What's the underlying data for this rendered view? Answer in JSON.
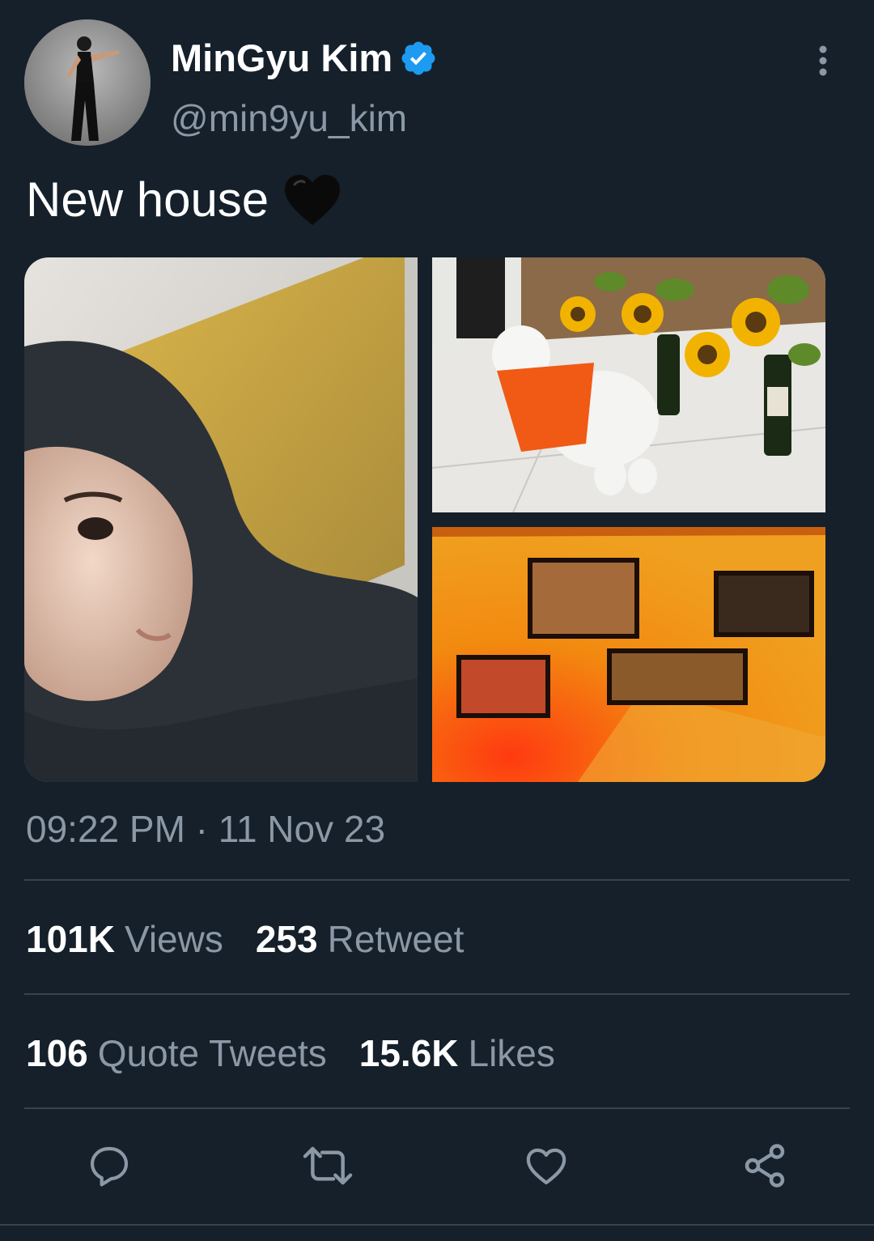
{
  "author": {
    "display_name": "MinGyu Kim",
    "handle": "@min9yu_kim",
    "verified": true,
    "avatar_icon": "avatar"
  },
  "tweet": {
    "text": "New house",
    "emoji": "black-heart-icon",
    "timestamp": "09:22 PM · 11 Nov 23"
  },
  "media": {
    "count": 3,
    "items": [
      "selfie-photo",
      "dog-photo",
      "wall-frames-photo"
    ]
  },
  "stats": {
    "views": {
      "value": "101K",
      "label": "Views"
    },
    "retweets": {
      "value": "253",
      "label": "Retweet"
    },
    "quotes": {
      "value": "106",
      "label": "Quote Tweets"
    },
    "likes": {
      "value": "15.6K",
      "label": "Likes"
    }
  },
  "actions": [
    "reply-icon",
    "retweet-icon",
    "like-icon",
    "share-icon"
  ],
  "colors": {
    "background": "#15202b",
    "secondary_text": "#8b98a5",
    "divider": "#38444d",
    "verified": "#1d9bf0"
  }
}
